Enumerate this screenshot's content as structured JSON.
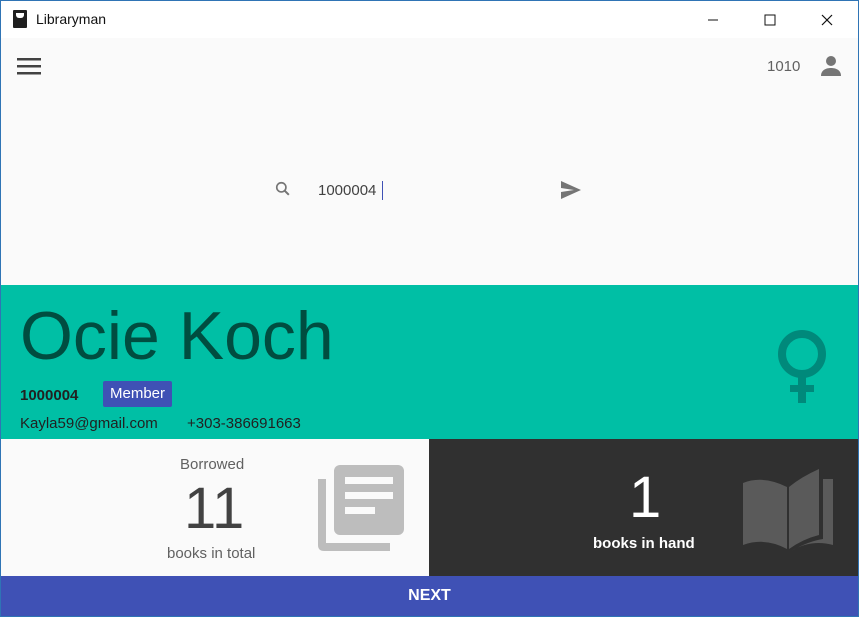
{
  "window": {
    "title": "Libraryman",
    "icon": "app-book-icon"
  },
  "toolbar": {
    "menu_icon": "hamburger-menu-icon",
    "user_id": "1010",
    "account_icon": "account-icon"
  },
  "search": {
    "value": "1000004",
    "icon": "search-icon",
    "submit_icon": "send-icon"
  },
  "member": {
    "name": "Ocie Koch",
    "id": "1000004",
    "badge": "Member",
    "email": "Kayla59@gmail.com",
    "phone": "+303-386691663",
    "gender_icon": "female-icon"
  },
  "stats": {
    "borrowed": {
      "title": "Borrowed",
      "count": "11",
      "subtitle": "books in total",
      "icon": "library-books-icon"
    },
    "in_hand": {
      "count": "1",
      "subtitle": "books in hand",
      "icon": "open-book-icon"
    }
  },
  "actions": {
    "next_label": "NEXT"
  },
  "colors": {
    "primary": "#3f51b5",
    "accent": "#00bfa5",
    "dark_panel": "#303030",
    "name_text": "#004d40"
  }
}
